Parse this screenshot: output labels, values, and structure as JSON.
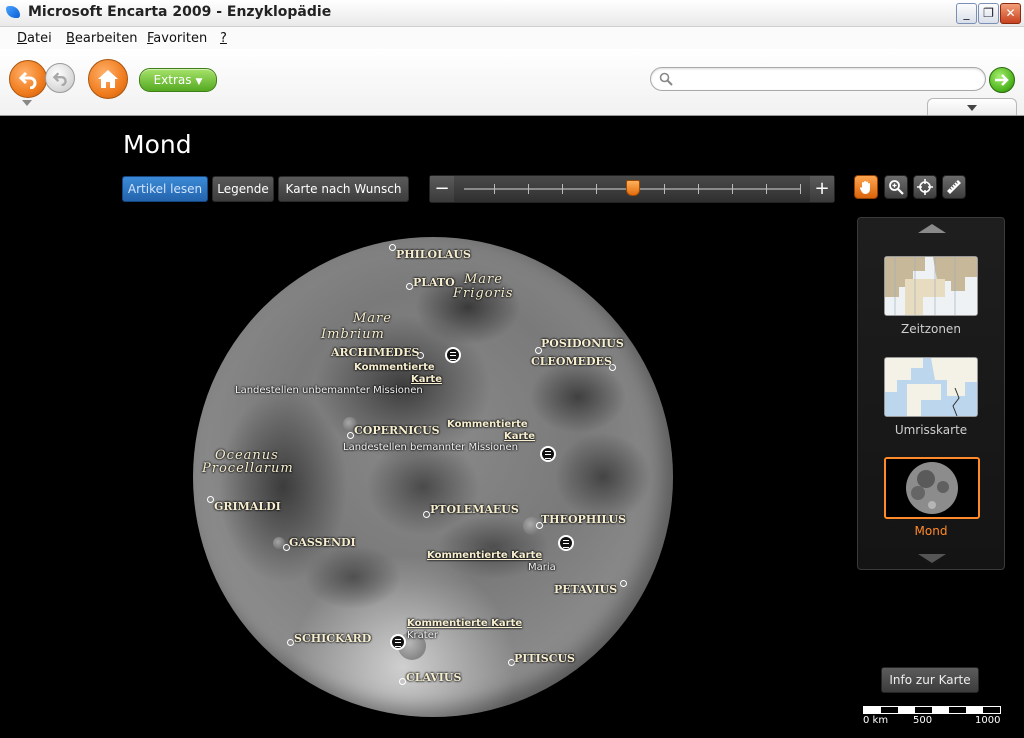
{
  "window": {
    "title": "Microsoft Encarta 2009 - Enzyklopädie",
    "min": "_",
    "max": "❐",
    "close": "✕"
  },
  "menu": [
    {
      "first": "D",
      "rest": "atei"
    },
    {
      "first": "B",
      "rest": "earbeiten"
    },
    {
      "first": "F",
      "rest": "avoriten"
    },
    {
      "first": "?",
      "rest": ""
    }
  ],
  "toolbar": {
    "extras_label": "Extras",
    "extras_arrow": "▼",
    "search_placeholder": "",
    "search_value": ""
  },
  "page": {
    "title": "Mond"
  },
  "map_toolbar": {
    "buttons": [
      "Artikel lesen",
      "Legende",
      "Karte nach Wunsch"
    ],
    "zoom_minus": "−",
    "zoom_plus": "+",
    "zoom_level_fraction": 0.5,
    "zoom_ticks": 10
  },
  "map": {
    "craters": [
      "PHILOLAUS",
      "PLATO",
      "ARCHIMEDES",
      "POSIDONIUS",
      "CLEOMEDES",
      "COPERNICUS",
      "GRIMALDI",
      "PTOLEMAEUS",
      "THEOPHILUS",
      "GASSENDI",
      "PETAVIUS",
      "SCHICKARD",
      "PITISCUS",
      "CLAVIUS"
    ],
    "seas": {
      "frigoris_1": "Mare",
      "frigoris_2": "Frigoris",
      "imbrium_1": "Mare",
      "imbrium_2": "Imbrium",
      "oceanus_1": "Oceanus",
      "oceanus_2": "Procellarum"
    },
    "annotations": [
      {
        "title_1": "Kommentierte",
        "title_2": "Karte",
        "subtitle": "Landestellen unbemannter Missionen"
      },
      {
        "title_1": "Kommentierte",
        "title_2": "Karte",
        "subtitle": "Landestellen bemannter Missionen"
      },
      {
        "title_1": "Kommentierte Karte",
        "title_2": "",
        "subtitle": "Maria"
      },
      {
        "title_1": "Kommentierte Karte",
        "title_2": "",
        "subtitle": "Krater"
      }
    ]
  },
  "side_panel": {
    "items": [
      {
        "label": "Zeitzonen",
        "selected": false
      },
      {
        "label": "Umrisskarte",
        "selected": false
      },
      {
        "label": "Mond",
        "selected": true
      }
    ],
    "accent": "#ff8a2a"
  },
  "info_button": "Info zur Karte",
  "scale_bar": {
    "labels": [
      "0 km",
      "500",
      "1000"
    ]
  }
}
